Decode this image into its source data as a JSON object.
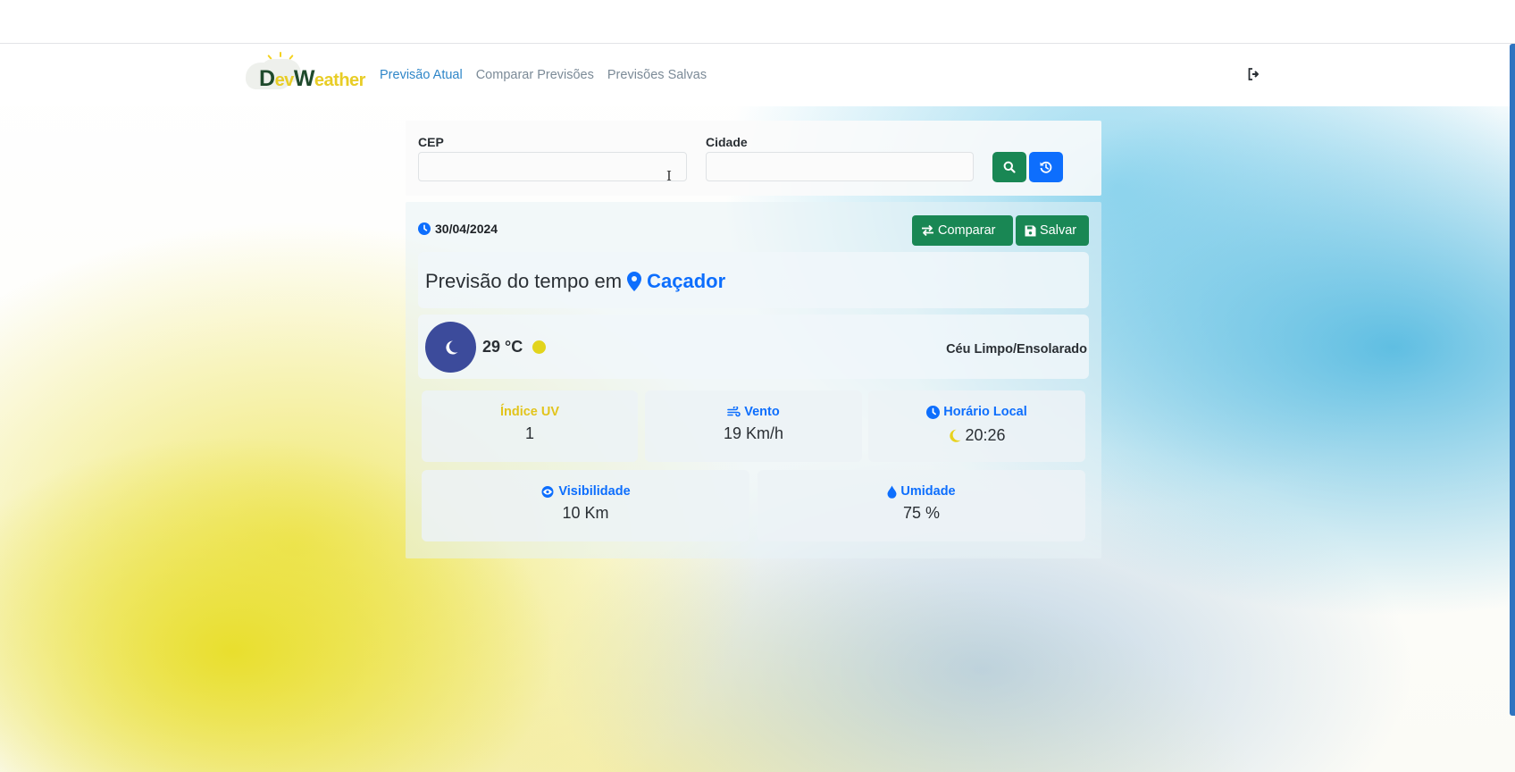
{
  "app": {
    "logo": {
      "text_1": "D",
      "text_2": "ev",
      "text_3": "W",
      "text_4": "eather"
    },
    "nav": {
      "links": [
        {
          "label": "Previsão Atual",
          "active": true
        },
        {
          "label": "Comparar Previsões",
          "active": false
        },
        {
          "label": "Previsões Salvas",
          "active": false
        }
      ],
      "logout_icon": "sign-out-icon"
    }
  },
  "search": {
    "cep_label": "CEP",
    "cep_value": "",
    "cidade_label": "Cidade",
    "cidade_value": "",
    "search_icon": "search-icon",
    "history_icon": "history-icon"
  },
  "forecast": {
    "date": "30/04/2024",
    "compare_label": "Comparar",
    "save_label": "Salvar",
    "title_prefix": "Previsão do tempo em",
    "city": "Caçador",
    "temperature": "29 °C",
    "condition": "Céu Limpo/Ensolarado",
    "stats": {
      "uv": {
        "label": "Índice UV",
        "value": "1"
      },
      "wind": {
        "label": "Vento",
        "value": "19 Km/h"
      },
      "local_time": {
        "label": "Horário Local",
        "value": "20:26"
      },
      "visibility": {
        "label": "Visibilidade",
        "value": "10 Km"
      },
      "humidity": {
        "label": "Umidade",
        "value": "75 %"
      }
    }
  },
  "colors": {
    "primary": "#0d6efd",
    "success": "#198754",
    "uv_yellow": "#e2c41c",
    "moon_bg": "#3c4b9b",
    "nav_active": "#2f86c8",
    "nav_inactive": "#7b8a97"
  }
}
